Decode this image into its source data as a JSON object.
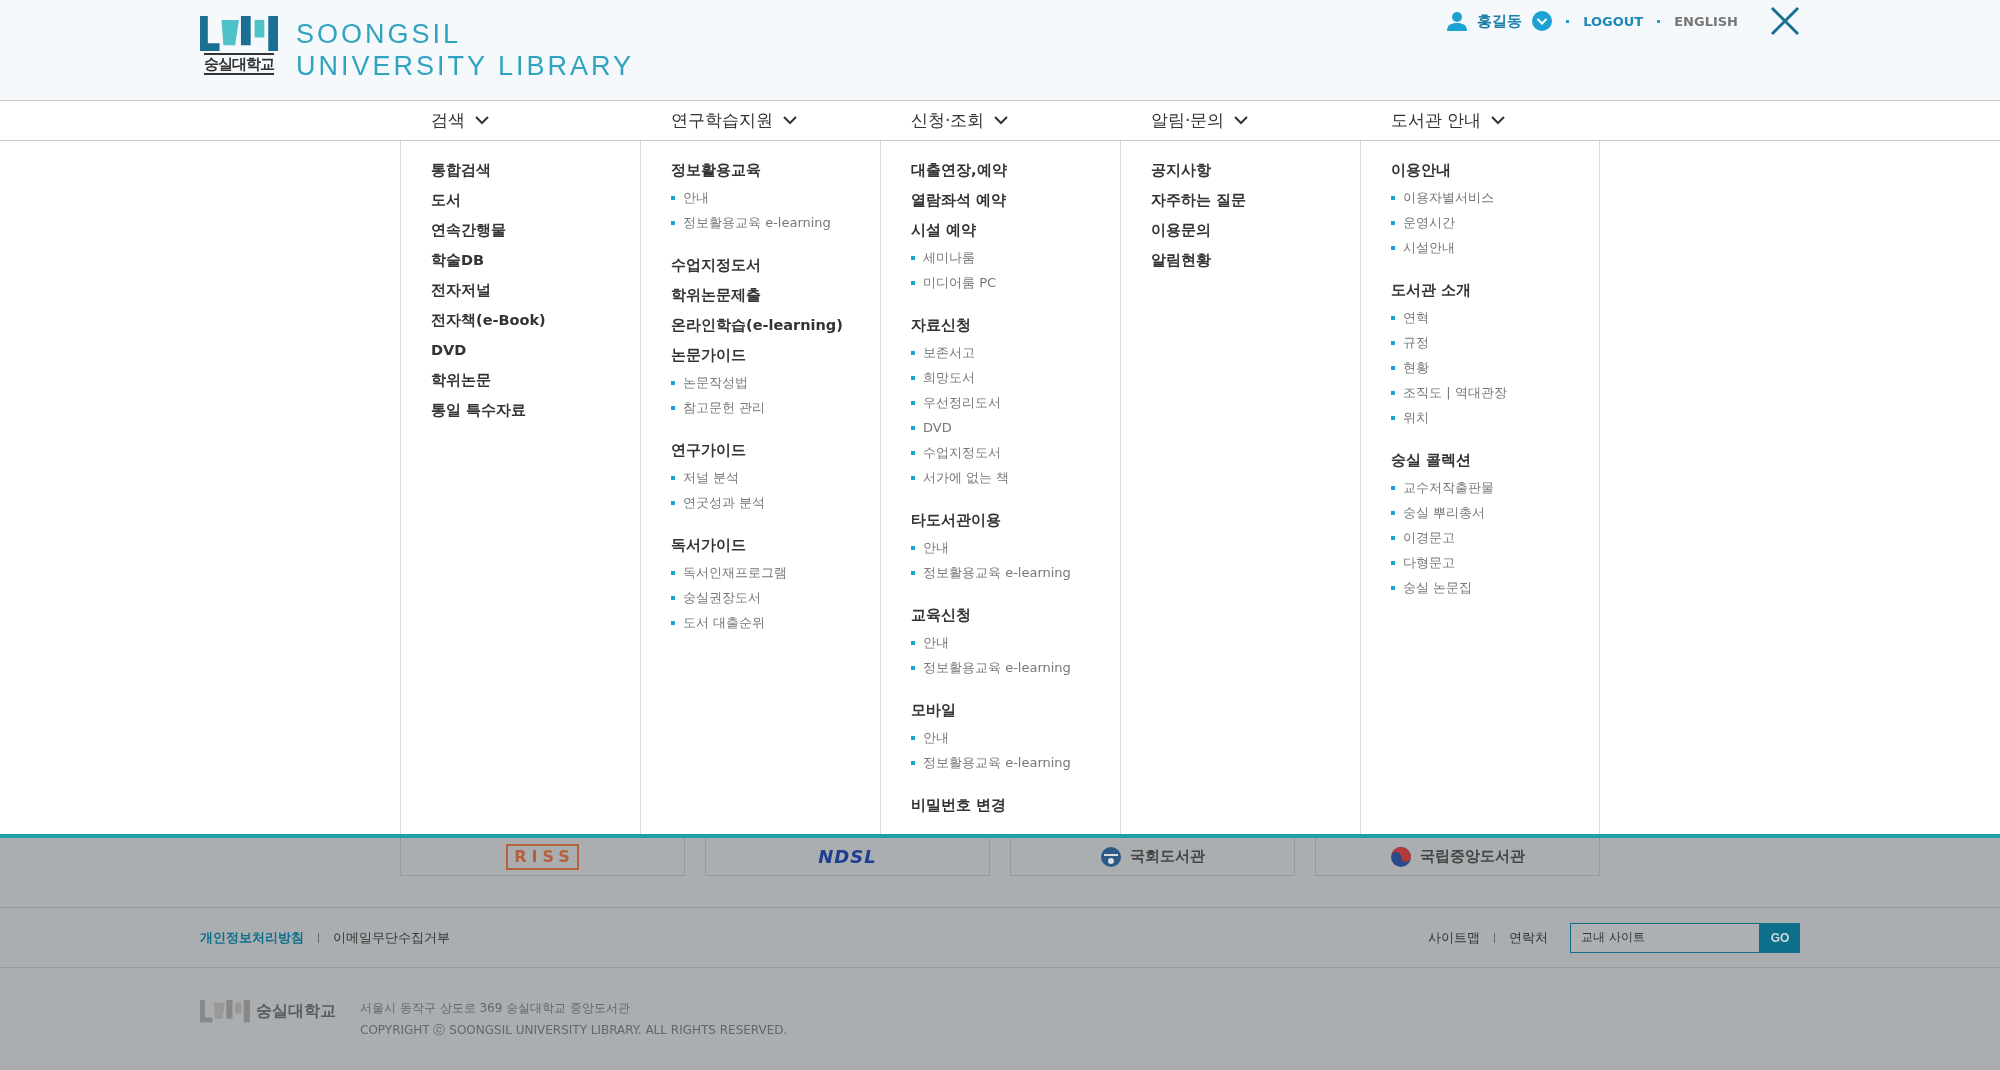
{
  "header": {
    "logo": {
      "korean": "숭실대학교",
      "line_1": "SOONGSIL",
      "line_2": "UNIVERSITY LIBRARY"
    },
    "user": {
      "name": "홍길동",
      "links": [
        "LOGOUT",
        "ENGLISH"
      ]
    }
  },
  "nav": [
    {
      "label": "검색",
      "sections": [
        {
          "title": "통합검색"
        },
        {
          "title": "도서"
        },
        {
          "title": "연속간행물"
        },
        {
          "title": "학술DB"
        },
        {
          "title": "전자저널"
        },
        {
          "title": "전자책(e-Book)"
        },
        {
          "title": "DVD"
        },
        {
          "title": "학위논문"
        },
        {
          "title": "통일 특수자료"
        }
      ]
    },
    {
      "label": "연구학습지원",
      "sections": [
        {
          "title": "정보활용교육",
          "items": [
            "안내",
            "정보활용교육 e-learning"
          ]
        },
        {
          "title": "수업지정도서"
        },
        {
          "title": "학위논문제출"
        },
        {
          "title": "온라인학습(e-learning)"
        },
        {
          "title": "논문가이드",
          "items": [
            "논문작성법",
            "참고문헌 관리"
          ]
        },
        {
          "title": "연구가이드",
          "items": [
            "저널 분석",
            "연굿성과 분석"
          ]
        },
        {
          "title": "독서가이드",
          "items": [
            "독서인재프로그램",
            "숭실권장도서",
            "도서 대출순위"
          ]
        }
      ]
    },
    {
      "label": "신청·조회",
      "sections": [
        {
          "title": "대출연장,예약"
        },
        {
          "title": "열람좌석 예약"
        },
        {
          "title": "시설 예약",
          "items": [
            "세미나룸",
            "미디어룸 PC"
          ]
        },
        {
          "title": "자료신청",
          "items": [
            "보존서고",
            "희망도서",
            "우선정리도서",
            "DVD",
            "수업지정도서",
            "서가에 없는 책"
          ]
        },
        {
          "title": "타도서관이용",
          "items": [
            "안내",
            "정보활용교육 e-learning"
          ]
        },
        {
          "title": "교육신청",
          "items": [
            "안내",
            "정보활용교육 e-learning"
          ]
        },
        {
          "title": "모바일",
          "items": [
            "안내",
            "정보활용교육 e-learning"
          ]
        },
        {
          "title": "비밀번호 변경"
        }
      ]
    },
    {
      "label": "알림·문의",
      "sections": [
        {
          "title": "공지사항"
        },
        {
          "title": "자주하는 질문"
        },
        {
          "title": "이용문의"
        },
        {
          "title": "알림현황"
        }
      ]
    },
    {
      "label": "도서관 안내",
      "sections": [
        {
          "title": "이용안내",
          "items": [
            "이용자별서비스",
            "운영시간",
            "시설안내"
          ]
        },
        {
          "title": "도서관 소개",
          "items": [
            "연혁",
            "규정",
            "현황",
            "조직도 | 역대관장",
            "위치"
          ]
        },
        {
          "title": "숭실 콜렉션",
          "items": [
            "교수저작출판물",
            "숭실 뿌리총서",
            "이경문고",
            "다형문고",
            "숭실 논문집"
          ]
        }
      ]
    }
  ],
  "partners": [
    {
      "kind": "riss",
      "label": "RISS"
    },
    {
      "kind": "ndsl",
      "label": "NDSL"
    },
    {
      "kind": "assembly",
      "label": "국회도서관"
    },
    {
      "kind": "national",
      "label": "국립중앙도서관"
    }
  ],
  "footer": {
    "left_links": [
      "개인정보처리방침",
      "이메일무단수집거부"
    ],
    "right_links": [
      "사이트맵",
      "연락처"
    ],
    "site_select": {
      "value": "교내 사이트"
    },
    "go_button": "GO",
    "logo_text": "숭실대학교",
    "address": "서울시 동작구 상도로 369  숭실대학교 중앙도서관",
    "copyright": "COPYRIGHT  ⓒ  SOONGSIL UNIVERSITY LIBRARY. ALL RIGHTS RESERVED."
  }
}
